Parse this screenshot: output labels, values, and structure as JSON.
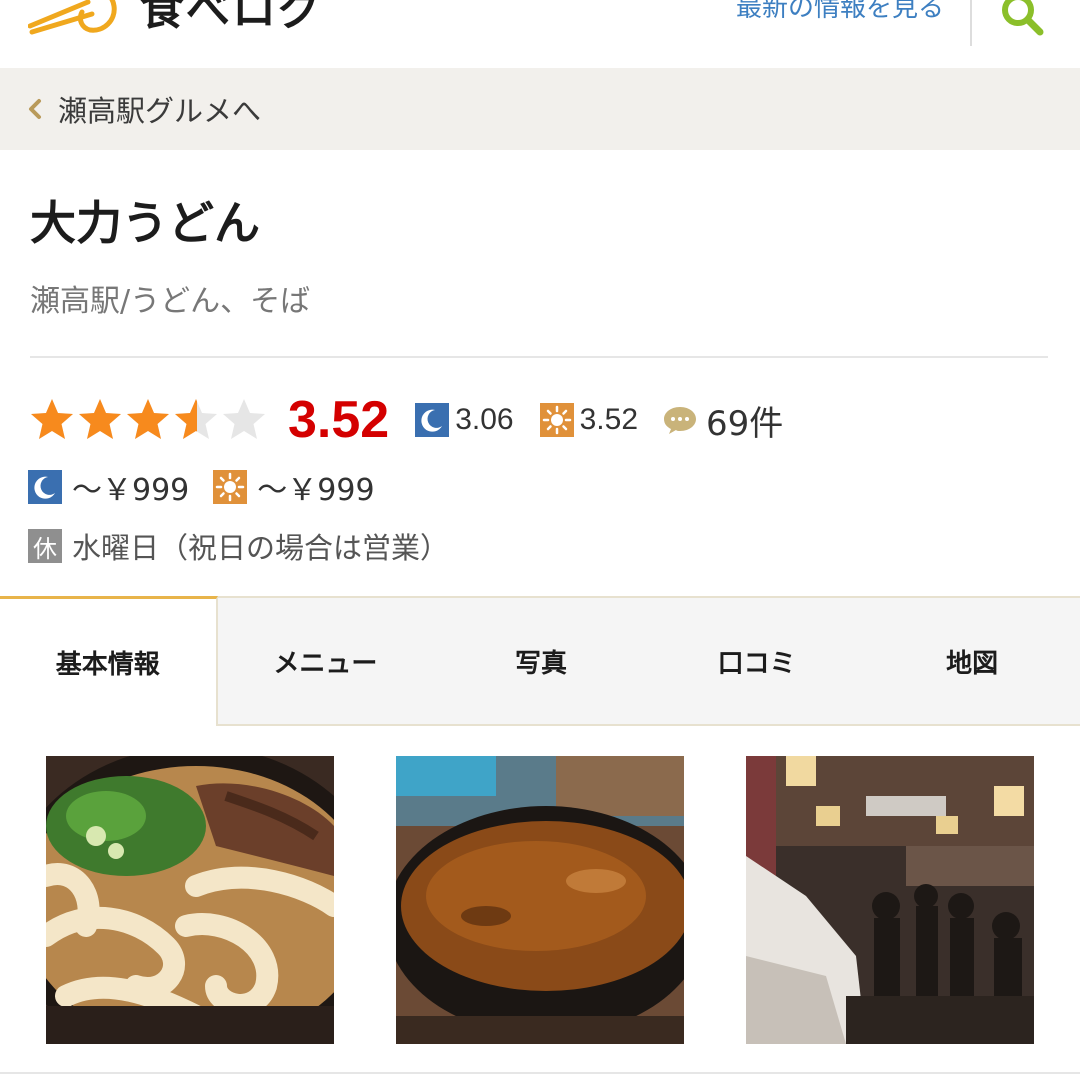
{
  "header": {
    "logo_text": "食べログ",
    "latest_link": "最新の情報を見る",
    "search_icon": "search-icon"
  },
  "breadcrumb": {
    "label": "瀬高駅グルメへ"
  },
  "shop": {
    "name": "大力うどん",
    "subtitle": "瀬高駅/うどん、そば"
  },
  "rating": {
    "stars_value": 3.52,
    "stars_max": 5,
    "score": "3.52",
    "dinner_score": "3.06",
    "lunch_score": "3.52",
    "review_count": "69件",
    "score_color": "#d40000",
    "star_color": "#f78a1d"
  },
  "budget": {
    "dinner": "～￥999",
    "lunch": "～￥999"
  },
  "holiday": {
    "badge": "休",
    "text": "水曜日（祝日の場合は営業）"
  },
  "tabs": [
    {
      "label": "基本情報",
      "active": true
    },
    {
      "label": "メニュー",
      "active": false
    },
    {
      "label": "写真",
      "active": false
    },
    {
      "label": "口コミ",
      "active": false
    },
    {
      "label": "地図",
      "active": false
    }
  ],
  "photos": [
    {
      "subject": "niku-udon-photo"
    },
    {
      "subject": "curry-udon-photo"
    },
    {
      "subject": "restaurant-interior-photo"
    }
  ],
  "colors": {
    "link_blue": "#3d7fc1",
    "accent_gold": "#e8b44a",
    "dinner_icon_blue": "#3a6fb0",
    "lunch_icon_orange": "#e0913a"
  }
}
